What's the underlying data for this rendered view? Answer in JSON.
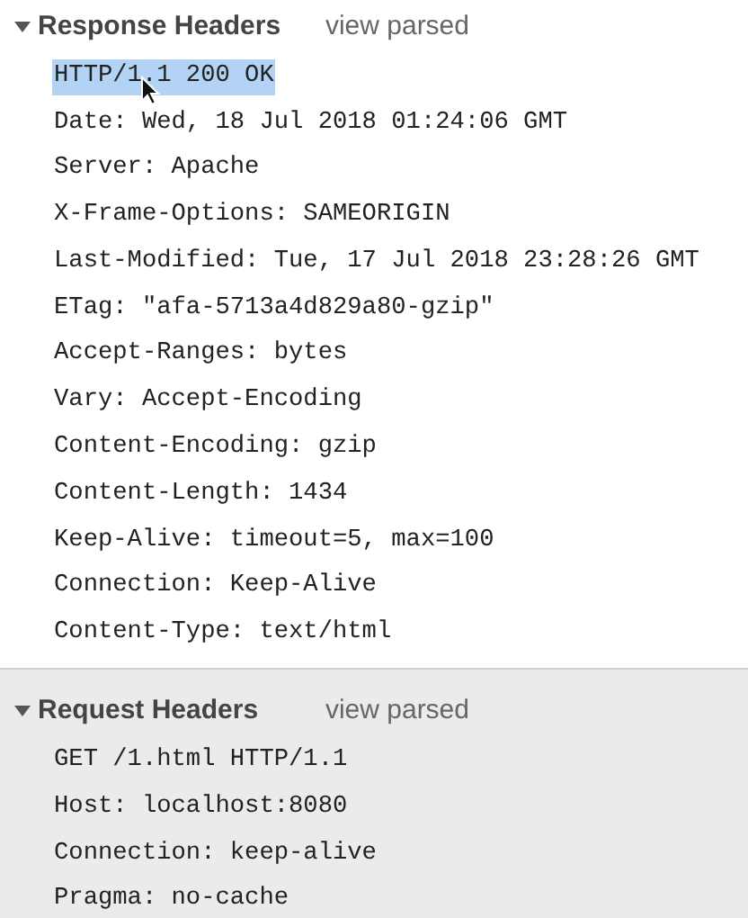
{
  "sections": [
    {
      "title": "Response Headers",
      "link": "view parsed",
      "expanded": true,
      "lines": [
        {
          "text": "HTTP/1.1 200 OK",
          "selected": true
        },
        {
          "text": "Date: Wed, 18 Jul 2018 01:24:06 GMT",
          "selected": false
        },
        {
          "text": "Server: Apache",
          "selected": false
        },
        {
          "text": "X-Frame-Options: SAMEORIGIN",
          "selected": false
        },
        {
          "text": "Last-Modified: Tue, 17 Jul 2018 23:28:26 GMT",
          "selected": false
        },
        {
          "text": "ETag: \"afa-5713a4d829a80-gzip\"",
          "selected": false
        },
        {
          "text": "Accept-Ranges: bytes",
          "selected": false
        },
        {
          "text": "Vary: Accept-Encoding",
          "selected": false
        },
        {
          "text": "Content-Encoding: gzip",
          "selected": false
        },
        {
          "text": "Content-Length: 1434",
          "selected": false
        },
        {
          "text": "Keep-Alive: timeout=5, max=100",
          "selected": false
        },
        {
          "text": "Connection: Keep-Alive",
          "selected": false
        },
        {
          "text": "Content-Type: text/html",
          "selected": false
        }
      ]
    },
    {
      "title": "Request Headers",
      "link": "view parsed",
      "expanded": true,
      "lines": [
        {
          "text": "GET /1.html HTTP/1.1",
          "selected": false
        },
        {
          "text": "Host: localhost:8080",
          "selected": false
        },
        {
          "text": "Connection: keep-alive",
          "selected": false
        },
        {
          "text": "Pragma: no-cache",
          "selected": false
        }
      ]
    }
  ]
}
